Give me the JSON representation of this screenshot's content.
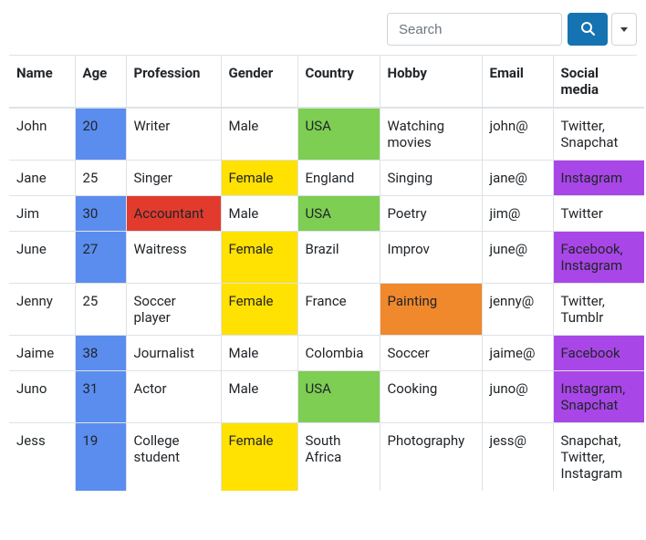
{
  "search": {
    "placeholder": "Search"
  },
  "colors": {
    "blue": "#5b8def",
    "yellow": "#ffe102",
    "green": "#7dce52",
    "red": "#e23b2e",
    "orange": "#f0882c",
    "purple": "#a946e8"
  },
  "columns": {
    "name": "Name",
    "age": "Age",
    "profession": "Profession",
    "gender": "Gender",
    "country": "Country",
    "hobby": "Hobby",
    "email": "Email",
    "social": "Social media"
  },
  "rows": [
    {
      "name": "John",
      "age": "20",
      "profession": "Writer",
      "gender": "Male",
      "country": "USA",
      "hobby": "Watching movies",
      "email": "john@",
      "social": "Twitter, Snapchat",
      "hl": {
        "age": "blue",
        "country": "green"
      }
    },
    {
      "name": "Jane",
      "age": "25",
      "profession": "Singer",
      "gender": "Female",
      "country": "England",
      "hobby": "Singing",
      "email": "jane@",
      "social": "Instagram",
      "hl": {
        "gender": "yellow",
        "social": "purple"
      }
    },
    {
      "name": "Jim",
      "age": "30",
      "profession": "Accountant",
      "gender": "Male",
      "country": "USA",
      "hobby": "Poetry",
      "email": "jim@",
      "social": "Twitter",
      "hl": {
        "age": "blue",
        "profession": "red",
        "country": "green"
      }
    },
    {
      "name": "June",
      "age": "27",
      "profession": "Waitress",
      "gender": "Female",
      "country": "Brazil",
      "hobby": "Improv",
      "email": "june@",
      "social": "Facebook, Instagram",
      "hl": {
        "age": "blue",
        "gender": "yellow",
        "social": "purple"
      }
    },
    {
      "name": "Jenny",
      "age": "25",
      "profession": "Soccer player",
      "gender": "Female",
      "country": "France",
      "hobby": "Painting",
      "email": "jenny@",
      "social": "Twitter, Tumblr",
      "hl": {
        "gender": "yellow",
        "hobby": "orange"
      }
    },
    {
      "name": "Jaime",
      "age": "38",
      "profession": "Journalist",
      "gender": "Male",
      "country": "Colombia",
      "hobby": "Soccer",
      "email": "jaime@",
      "social": "Facebook",
      "hl": {
        "age": "blue",
        "social": "purple"
      }
    },
    {
      "name": "Juno",
      "age": "31",
      "profession": "Actor",
      "gender": "Male",
      "country": "USA",
      "hobby": "Cooking",
      "email": "juno@",
      "social": "Instagram, Snapchat",
      "hl": {
        "age": "blue",
        "country": "green",
        "social": "purple"
      }
    },
    {
      "name": "Jess",
      "age": "19",
      "profession": "College student",
      "gender": "Female",
      "country": "South Africa",
      "hobby": "Photography",
      "email": "jess@",
      "social": "Snapchat, Twitter, Instagram",
      "hl": {
        "age": "blue",
        "gender": "yellow"
      }
    }
  ]
}
